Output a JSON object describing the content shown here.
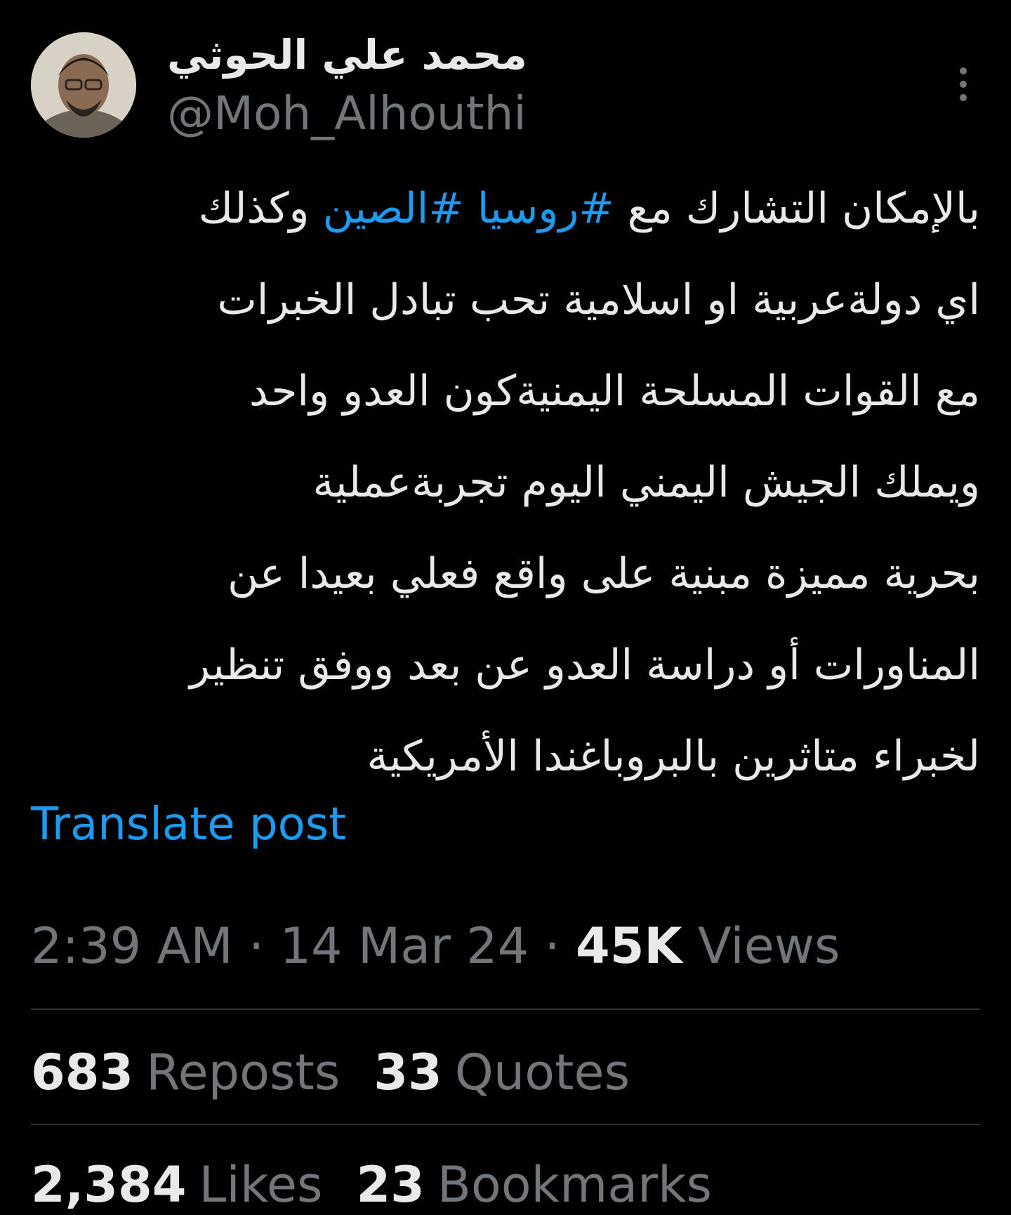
{
  "author": {
    "name": "محمد علي الحوثي",
    "handle": "@Moh_Alhouthi"
  },
  "post": {
    "line1": {
      "before": "بالإمكان التشارك مع ",
      "hashtag1": "#روسيا",
      "hashtag2": "#الصين",
      "after": " وكذلك"
    },
    "lines": [
      "اي دولةعربية او اسلامية تحب تبادل الخبرات",
      "مع القوات المسلحة اليمنيةكون العدو واحد",
      "ويملك الجيش اليمني اليوم تجربةعملية",
      "بحرية مميزة مبنية على واقع فعلي بعيدا عن",
      "المناورات أو دراسة العدو عن بعد ووفق تنظير",
      "لخبراء متاثرين بالبروباغندا الأمريكية"
    ]
  },
  "translate_label": "Translate post",
  "meta": {
    "time": "2:39 AM",
    "separator": " · ",
    "date": "14 Mar 24",
    "views_count": "45K",
    "views_label": "Views"
  },
  "stats": {
    "reposts_count": "683",
    "reposts_label": "Reposts",
    "quotes_count": "33",
    "quotes_label": "Quotes",
    "likes_count": "2,384",
    "likes_label": "Likes",
    "bookmarks_count": "23",
    "bookmarks_label": "Bookmarks"
  },
  "colors": {
    "background": "#000000",
    "text_primary": "#e7e9ea",
    "text_secondary": "#71767b",
    "accent": "#1d9bf0",
    "divider": "#2f3336"
  }
}
